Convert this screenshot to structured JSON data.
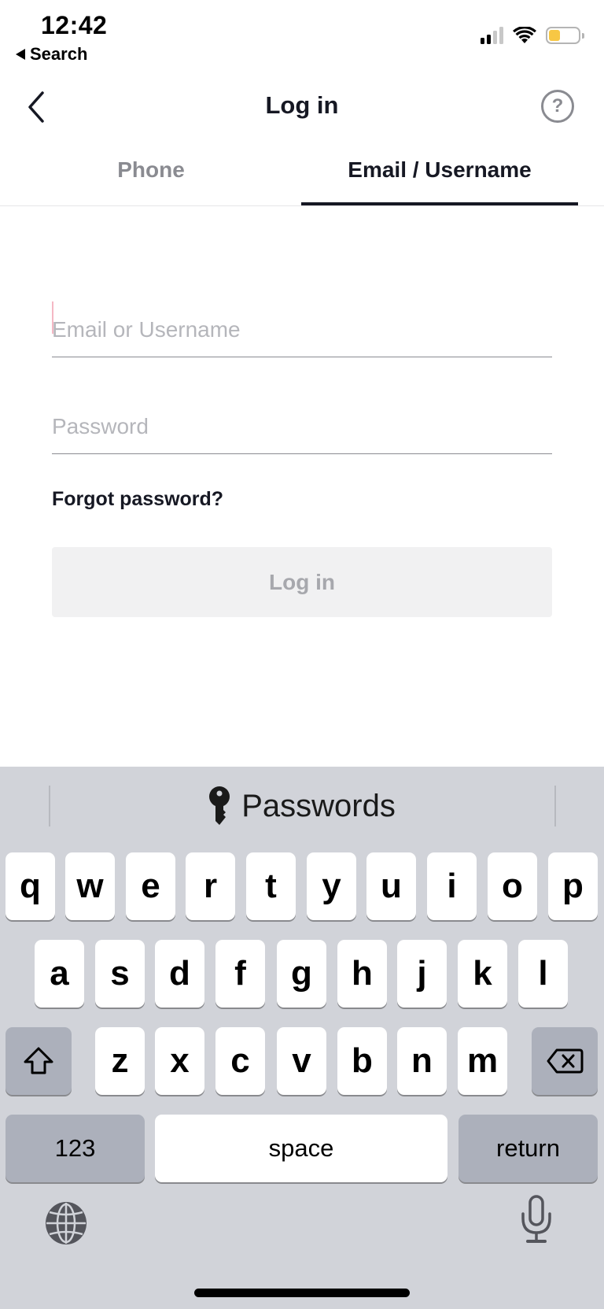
{
  "status_bar": {
    "time": "12:42",
    "back_app": "Search",
    "signal_bars_active": 2,
    "signal_bars_total": 4,
    "battery_level": 0.35,
    "battery_color": "#f7c744",
    "icons": [
      "signal-icon",
      "wifi-icon",
      "battery-icon"
    ]
  },
  "nav": {
    "title": "Log in",
    "back_icon": "chevron-left-icon",
    "help_icon": "question-circle-icon",
    "help_glyph": "?"
  },
  "tabs": [
    {
      "label": "Phone",
      "active": false
    },
    {
      "label": "Email / Username",
      "active": true
    }
  ],
  "form": {
    "email": {
      "value": "",
      "placeholder": "Email or Username"
    },
    "password": {
      "value": "",
      "placeholder": "Password"
    },
    "forgot_label": "Forgot password?",
    "submit_label": "Log in",
    "accent": "#fe2c55"
  },
  "keyboard": {
    "suggestion": {
      "icon": "key-icon",
      "label": "Passwords"
    },
    "rows": [
      [
        "q",
        "w",
        "e",
        "r",
        "t",
        "y",
        "u",
        "i",
        "o",
        "p"
      ],
      [
        "a",
        "s",
        "d",
        "f",
        "g",
        "h",
        "j",
        "k",
        "l"
      ],
      [
        "z",
        "x",
        "c",
        "v",
        "b",
        "n",
        "m"
      ]
    ],
    "shift_icon": "shift-icon",
    "delete_icon": "delete-icon",
    "numbers_label": "123",
    "space_label": "space",
    "return_label": "return",
    "globe_icon": "globe-icon",
    "mic_icon": "microphone-icon"
  }
}
